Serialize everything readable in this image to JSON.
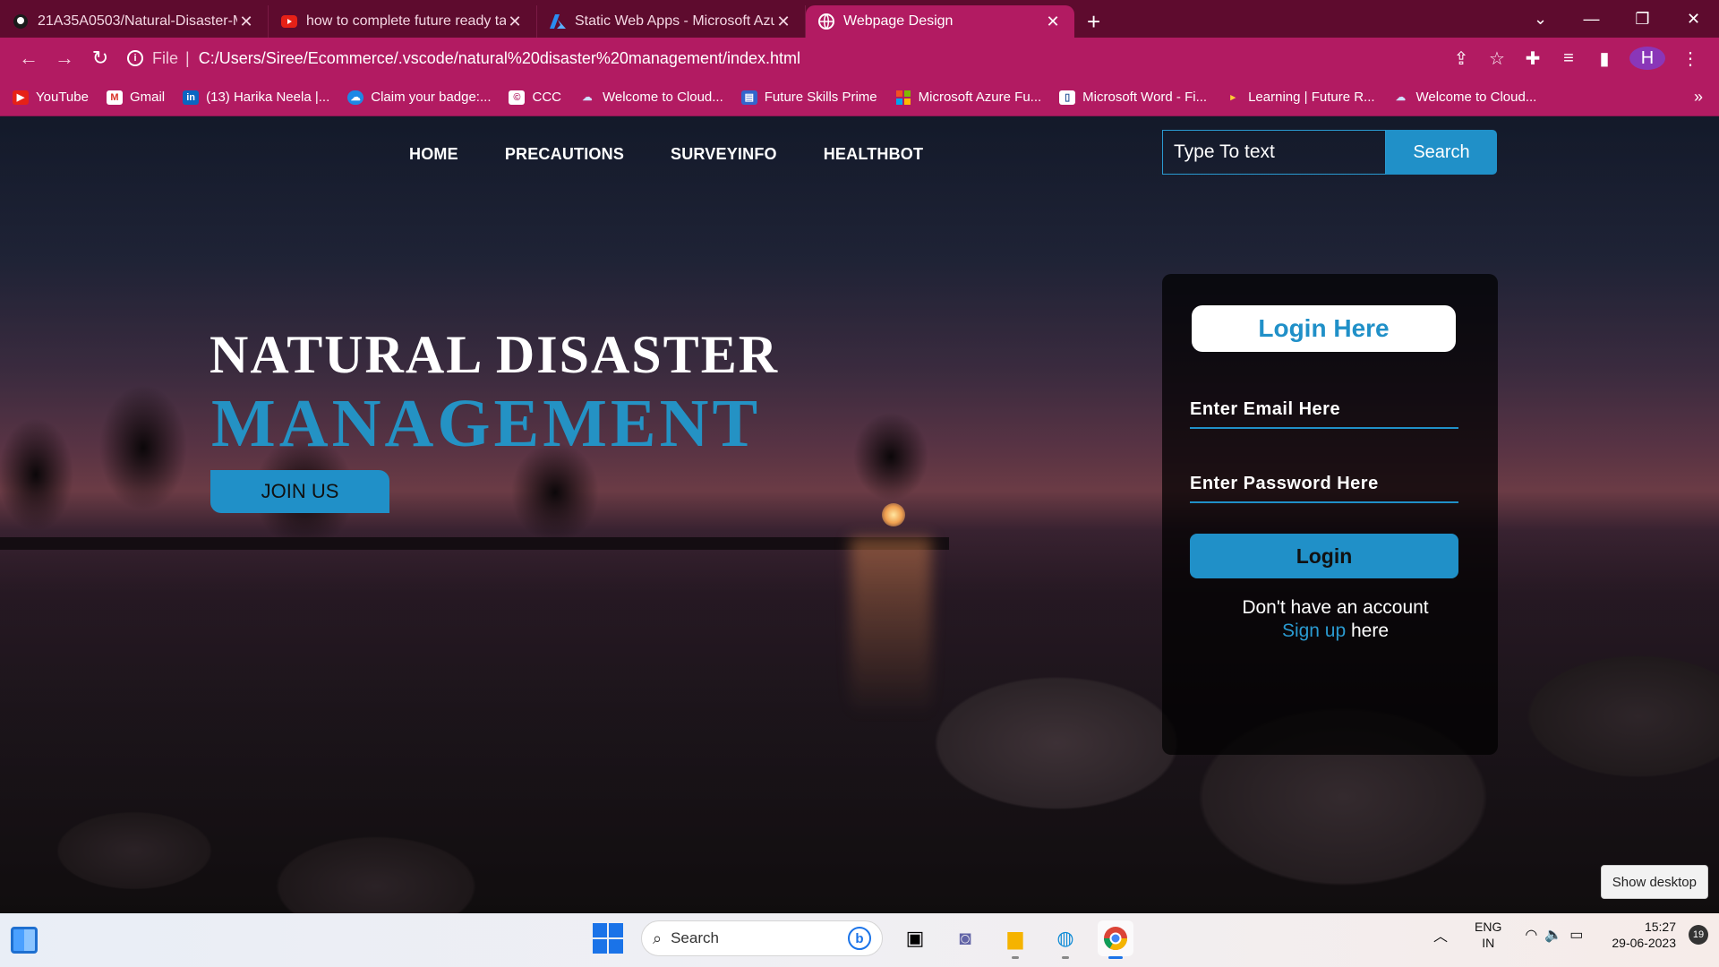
{
  "browser": {
    "tabs": [
      {
        "title": "21A35A0503/Natural-Disaster-M",
        "icon": "github-icon",
        "active": false
      },
      {
        "title": "how to complete future ready tal",
        "icon": "youtube-icon",
        "active": false
      },
      {
        "title": "Static Web Apps - Microsoft Azur",
        "icon": "azure-icon",
        "active": false
      },
      {
        "title": "Webpage Design",
        "icon": "globe-icon",
        "active": true
      }
    ],
    "address": {
      "scheme": "File",
      "url": "C:/Users/Siree/Ecommerce/.vscode/natural%20disaster%20management/index.html"
    },
    "profile_initial": "H",
    "bookmarks": [
      {
        "label": "YouTube",
        "icon": "youtube-icon",
        "color": "#e62117"
      },
      {
        "label": "Gmail",
        "icon": "gmail-icon",
        "color": "#d93025"
      },
      {
        "label": "(13) Harika Neela |...",
        "icon": "linkedin-icon",
        "color": "#0a66c2"
      },
      {
        "label": "Claim your badge:...",
        "icon": "cloud-icon",
        "color": "#1e88e5"
      },
      {
        "label": "CCC",
        "icon": "ccc-icon",
        "color": "#ffffff"
      },
      {
        "label": "Welcome to Cloud...",
        "icon": "cloud-outline-icon",
        "color": "#9ec3ff"
      },
      {
        "label": "Future Skills Prime",
        "icon": "futureskills-icon",
        "color": "#3366cc"
      },
      {
        "label": "Microsoft Azure Fu...",
        "icon": "microsoft-icon",
        "color": "#f25022"
      },
      {
        "label": "Microsoft Word - Fi...",
        "icon": "document-icon",
        "color": "#ffffff"
      },
      {
        "label": "Learning | Future R...",
        "icon": "flag-icon",
        "color": "#4caf50"
      },
      {
        "label": "Welcome to Cloud...",
        "icon": "cloud-outline-icon",
        "color": "#9ec3ff"
      }
    ]
  },
  "page": {
    "nav": [
      "HOME",
      "PRECAUTIONS",
      "SURVEYINFO",
      "HEALTHBOT"
    ],
    "search": {
      "placeholder": "Type To text",
      "button": "Search"
    },
    "hero": {
      "line1": "NATURAL DISASTER",
      "line2": "MANAGEMENT",
      "join_button": "JOIN US"
    },
    "login": {
      "heading": "Login Here",
      "email_placeholder": "Enter Email Here",
      "password_placeholder": "Enter Password Here",
      "button": "Login",
      "no_account": "Don't have an account",
      "signup_link": "Sign up",
      "signup_suffix": " here"
    },
    "show_desktop": "Show desktop"
  },
  "taskbar": {
    "search_label": "Search",
    "language": "ENG",
    "region": "IN",
    "time": "15:27",
    "date": "29-06-2023",
    "notifications": "19"
  },
  "colors": {
    "accent": "#2090c8",
    "chrome": "#b21b62",
    "tabbar": "#5e0b2e"
  }
}
